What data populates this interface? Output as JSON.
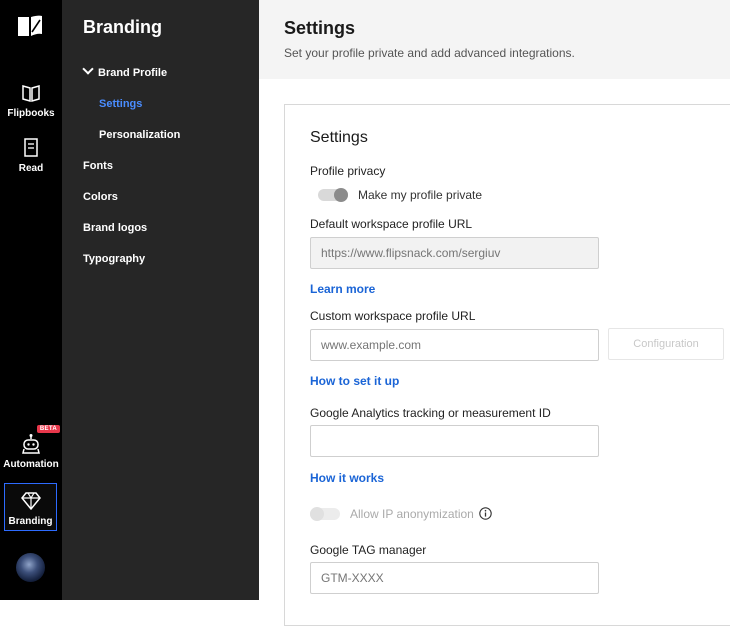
{
  "rail": {
    "items": [
      {
        "label": "Flipbooks",
        "icon": "book-open-icon"
      },
      {
        "label": "Read",
        "icon": "document-icon"
      },
      {
        "label": "Automation",
        "icon": "robot-icon",
        "badge": "BETA"
      },
      {
        "label": "Branding",
        "icon": "diamond-icon",
        "active": true
      }
    ]
  },
  "menu": {
    "title": "Branding",
    "items": [
      {
        "label": "Brand Profile",
        "expanded": true
      },
      {
        "label": "Settings",
        "active": true
      },
      {
        "label": "Personalization"
      },
      {
        "label": "Fonts"
      },
      {
        "label": "Colors"
      },
      {
        "label": "Brand logos"
      },
      {
        "label": "Typography"
      }
    ]
  },
  "header": {
    "title": "Settings",
    "subtitle": "Set your profile private and add advanced integrations."
  },
  "card": {
    "title": "Settings",
    "profile_privacy_label": "Profile privacy",
    "private_toggle_label": "Make my profile private",
    "default_url_label": "Default workspace profile URL",
    "default_url_placeholder": "https://www.flipsnack.com/sergiuv",
    "learn_more": "Learn more",
    "custom_url_label": "Custom workspace profile URL",
    "custom_url_placeholder": "www.example.com",
    "configuration_button": "Configuration",
    "how_to_set": "How to set it up",
    "ga_label": "Google Analytics tracking or measurement ID",
    "ga_placeholder": "",
    "how_it_works": "How it works",
    "ip_toggle_label": "Allow IP anonymization",
    "gtm_label": "Google TAG manager",
    "gtm_placeholder": "GTM-XXXX"
  },
  "colors": {
    "accent": "#1a64d6",
    "active_menu": "#4a8dff",
    "rail_bg": "#000000",
    "menu_bg": "#262626",
    "beta_badge": "#e8374b"
  }
}
